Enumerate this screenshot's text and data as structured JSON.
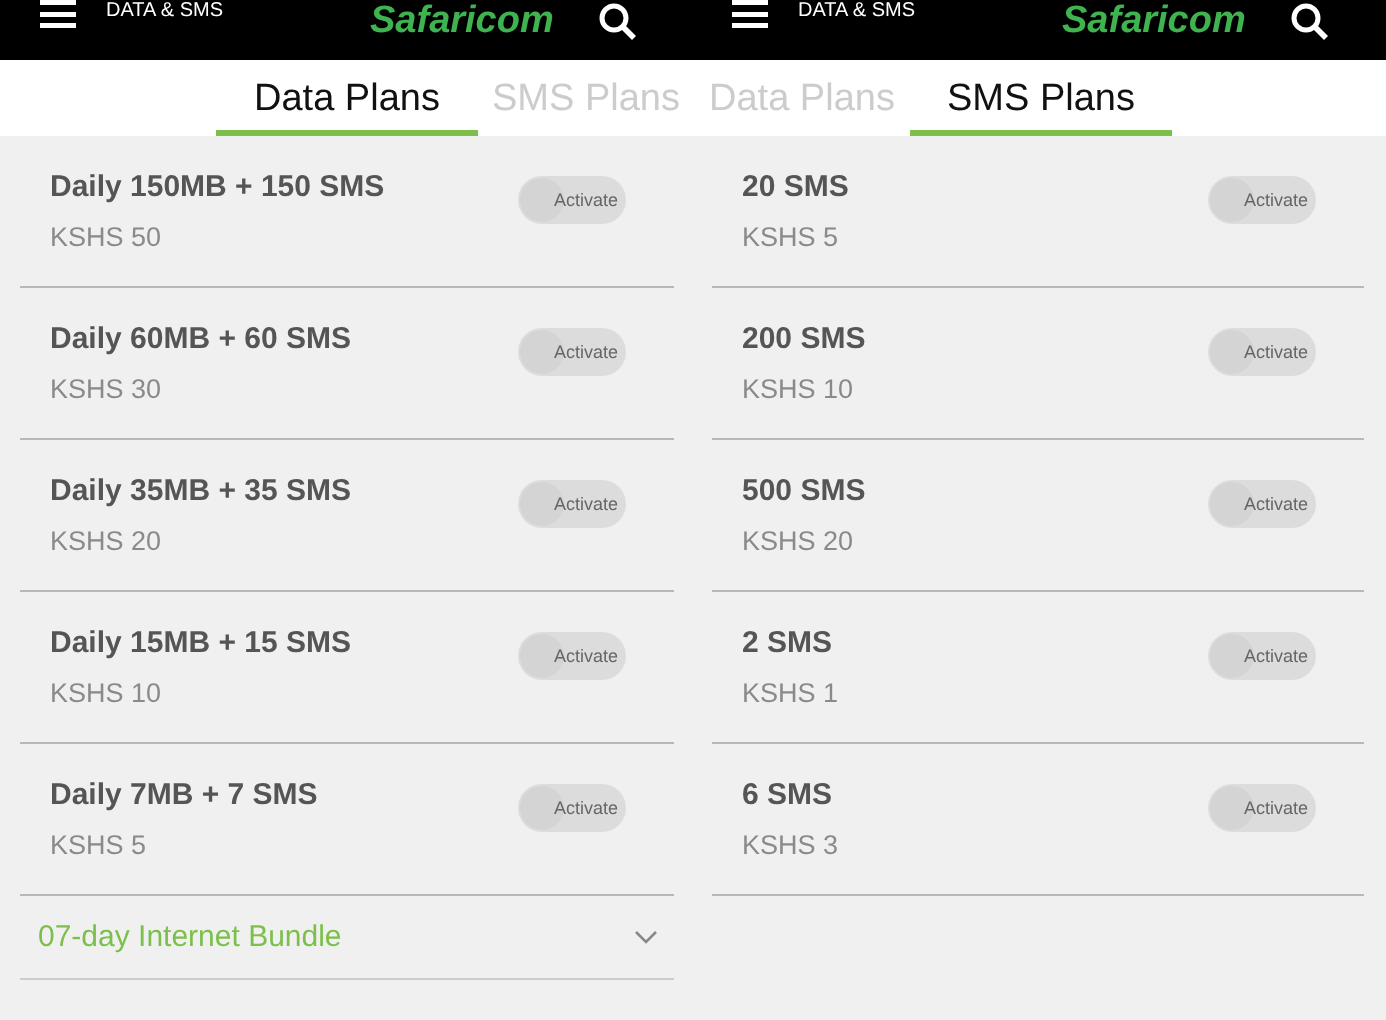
{
  "panels": [
    {
      "header": {
        "title": "DATA & SMS",
        "logo": "Safaricom"
      },
      "plans": [
        {
          "name": "Daily 150MB + 150 SMS",
          "price": "KSHS 50",
          "toggle": {
            "label": "Activate",
            "on": false
          }
        },
        {
          "name": "Daily 60MB + 60 SMS",
          "price": "KSHS 30",
          "toggle": {
            "label": "Activate",
            "on": false
          }
        },
        {
          "name": "Daily 35MB + 35 SMS",
          "price": "KSHS 20",
          "toggle": {
            "label": "Activate",
            "on": false
          }
        },
        {
          "name": "Daily 15MB + 15 SMS",
          "price": "KSHS 10",
          "toggle": {
            "label": "Activate",
            "on": false
          }
        },
        {
          "name": "Daily 7MB + 7 SMS",
          "price": "KSHS 5",
          "toggle": {
            "label": "Activate",
            "on": false
          }
        }
      ],
      "sections": [
        {
          "label": "07-day Internet Bundle",
          "expanded": false
        }
      ]
    },
    {
      "header": {
        "title": "DATA & SMS",
        "logo": "Safaricom"
      },
      "plans": [
        {
          "name": "20 SMS",
          "price": "KSHS 5",
          "toggle": {
            "label": "Activate",
            "on": false
          }
        },
        {
          "name": "200 SMS",
          "price": "KSHS 10",
          "toggle": {
            "label": "Activate",
            "on": false
          }
        },
        {
          "name": "500 SMS",
          "price": "KSHS 20",
          "toggle": {
            "label": "Activate",
            "on": false
          }
        },
        {
          "name": "2 SMS",
          "price": "KSHS 1",
          "toggle": {
            "label": "Activate",
            "on": false
          }
        },
        {
          "name": "6 SMS",
          "price": "KSHS 3",
          "toggle": {
            "label": "Activate",
            "on": false
          }
        }
      ]
    }
  ],
  "tabs": [
    {
      "label": "Data Plans",
      "selected": true
    },
    {
      "label": "SMS Plans",
      "selected": false
    },
    {
      "label": "Data Plans",
      "selected": false
    },
    {
      "label": "SMS Plans",
      "selected": true
    }
  ]
}
